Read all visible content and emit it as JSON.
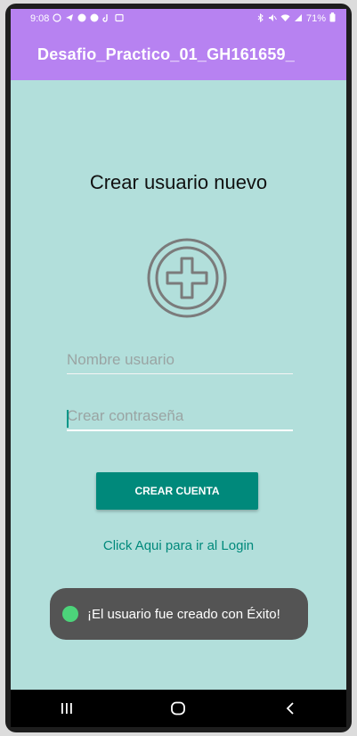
{
  "statusbar": {
    "time": "9:08",
    "battery": "71%",
    "left_icons": [
      "whatsapp-icon",
      "telegram-icon",
      "facebook-icon",
      "facebook-icon",
      "tiktok-icon",
      "gallery-icon"
    ],
    "right_icons": [
      "bluetooth-icon",
      "mute-icon",
      "wifi-icon",
      "signal-icon",
      "battery-icon"
    ]
  },
  "appbar": {
    "title": "Desafio_Practico_01_GH161659_"
  },
  "form": {
    "heading": "Crear usuario nuevo",
    "username_placeholder": "Nombre usuario",
    "password_placeholder": "Crear contraseña",
    "create_button": "CREAR CUENTA",
    "login_link": "Click Aqui para ir al Login"
  },
  "toast": {
    "message": "¡El usuario fue creado con Éxito!"
  },
  "navigation": {
    "icons": [
      "recents-icon",
      "home-icon",
      "back-icon"
    ]
  },
  "colors": {
    "appbar": "#b782f1",
    "background": "#b2dfdb",
    "accent": "#00897b",
    "toast_bg": "#545454",
    "toast_dot": "#4cd47a"
  }
}
